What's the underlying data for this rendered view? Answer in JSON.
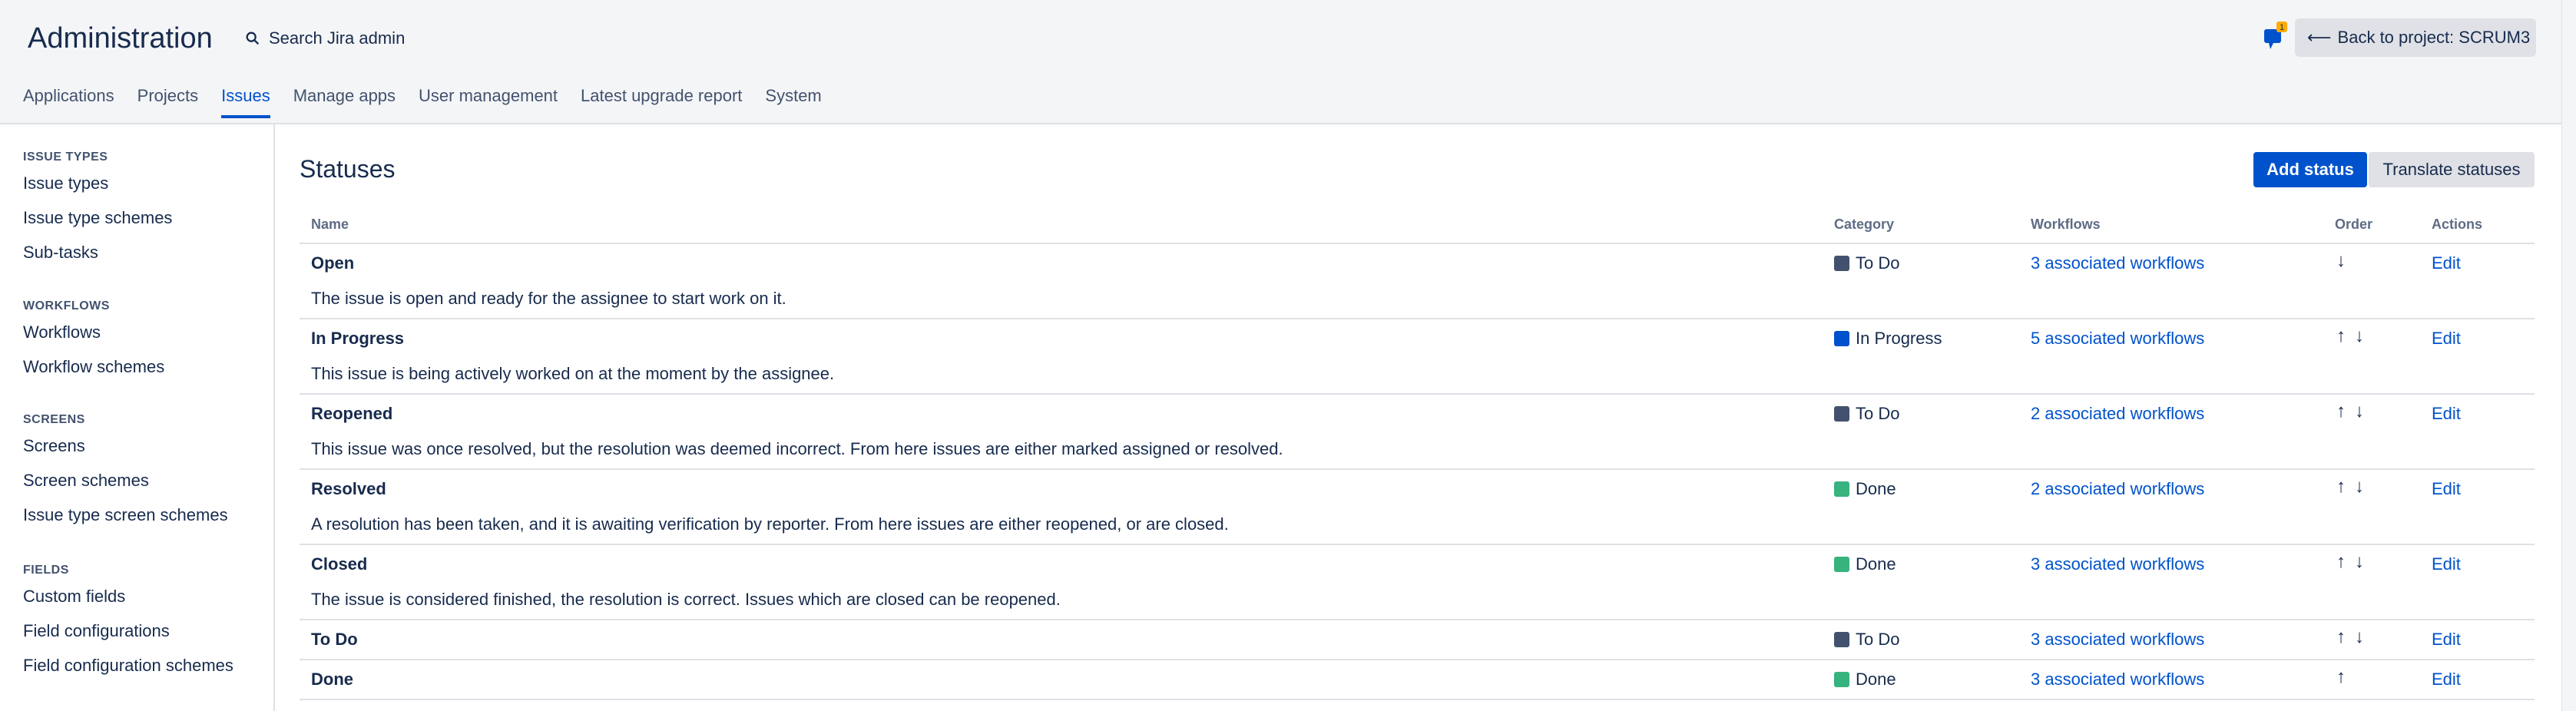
{
  "header": {
    "title": "Administration",
    "search_label": "Search Jira admin",
    "back_button": "Back to project: SCRUM3",
    "notification_count": "1"
  },
  "nav": {
    "tabs": [
      "Applications",
      "Projects",
      "Issues",
      "Manage apps",
      "User management",
      "Latest upgrade report",
      "System"
    ],
    "active": "Issues"
  },
  "sidebar": {
    "groups": [
      {
        "heading": "ISSUE TYPES",
        "items": [
          "Issue types",
          "Issue type schemes",
          "Sub-tasks"
        ]
      },
      {
        "heading": "WORKFLOWS",
        "items": [
          "Workflows",
          "Workflow schemes"
        ]
      },
      {
        "heading": "SCREENS",
        "items": [
          "Screens",
          "Screen schemes",
          "Issue type screen schemes"
        ]
      },
      {
        "heading": "FIELDS",
        "items": [
          "Custom fields",
          "Field configurations",
          "Field configuration schemes"
        ]
      }
    ]
  },
  "main": {
    "title": "Statuses",
    "add_button": "Add status",
    "translate_button": "Translate statuses",
    "columns": {
      "name": "Name",
      "category": "Category",
      "workflows": "Workflows",
      "order": "Order",
      "actions": "Actions"
    },
    "rows": [
      {
        "name": "Open",
        "description": "The issue is open and ready for the assignee to start work on it.",
        "category": "To Do",
        "workflows": "3 associated workflows",
        "action": "Edit"
      },
      {
        "name": "In Progress",
        "description": "This issue is being actively worked on at the moment by the assignee.",
        "category": "In Progress",
        "workflows": "5 associated workflows",
        "action": "Edit"
      },
      {
        "name": "Reopened",
        "description": "This issue was once resolved, but the resolution was deemed incorrect. From here issues are either marked assigned or resolved.",
        "category": "To Do",
        "workflows": "2 associated workflows",
        "action": "Edit"
      },
      {
        "name": "Resolved",
        "description": "A resolution has been taken, and it is awaiting verification by reporter. From here issues are either reopened, or are closed.",
        "category": "Done",
        "workflows": "2 associated workflows",
        "action": "Edit"
      },
      {
        "name": "Closed",
        "description": "The issue is considered finished, the resolution is correct. Issues which are closed can be reopened.",
        "category": "Done",
        "workflows": "3 associated workflows",
        "action": "Edit"
      },
      {
        "name": "To Do",
        "description": "",
        "category": "To Do",
        "workflows": "3 associated workflows",
        "action": "Edit"
      },
      {
        "name": "Done",
        "description": "",
        "category": "Done",
        "workflows": "3 associated workflows",
        "action": "Edit"
      }
    ]
  },
  "colors": {
    "todo": "#42526E",
    "inprogress": "#0052CC",
    "done": "#36B37E",
    "accent": "#0052CC"
  }
}
